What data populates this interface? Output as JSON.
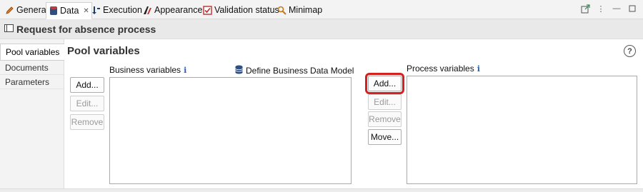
{
  "tabs": [
    {
      "label": "General",
      "icon": "pencil-icon"
    },
    {
      "label": "Data",
      "icon": "database-icon",
      "active": true,
      "closable": true
    },
    {
      "label": "Execution",
      "icon": "execution-icon"
    },
    {
      "label": "Appearance",
      "icon": "appearance-icon"
    },
    {
      "label": "Validation status",
      "icon": "checkbox-icon"
    },
    {
      "label": "Minimap",
      "icon": "magnifier-icon"
    }
  ],
  "header": {
    "title": "Request for absence process"
  },
  "sidetabs": [
    {
      "label": "Pool variables",
      "active": true
    },
    {
      "label": "Documents"
    },
    {
      "label": "Parameters"
    }
  ],
  "main": {
    "title": "Pool variables",
    "business": {
      "label": "Business variables",
      "define_label": "Define Business Data Model",
      "buttons": {
        "add": "Add...",
        "edit": "Edit...",
        "remove": "Remove"
      }
    },
    "process": {
      "label": "Process variables",
      "buttons": {
        "add": "Add...",
        "edit": "Edit...",
        "remove": "Remove",
        "move": "Move..."
      }
    },
    "info_glyph": "i",
    "help_glyph": "?"
  },
  "colors": {
    "highlight": "#d61f1f",
    "info": "#2b5fb4"
  }
}
